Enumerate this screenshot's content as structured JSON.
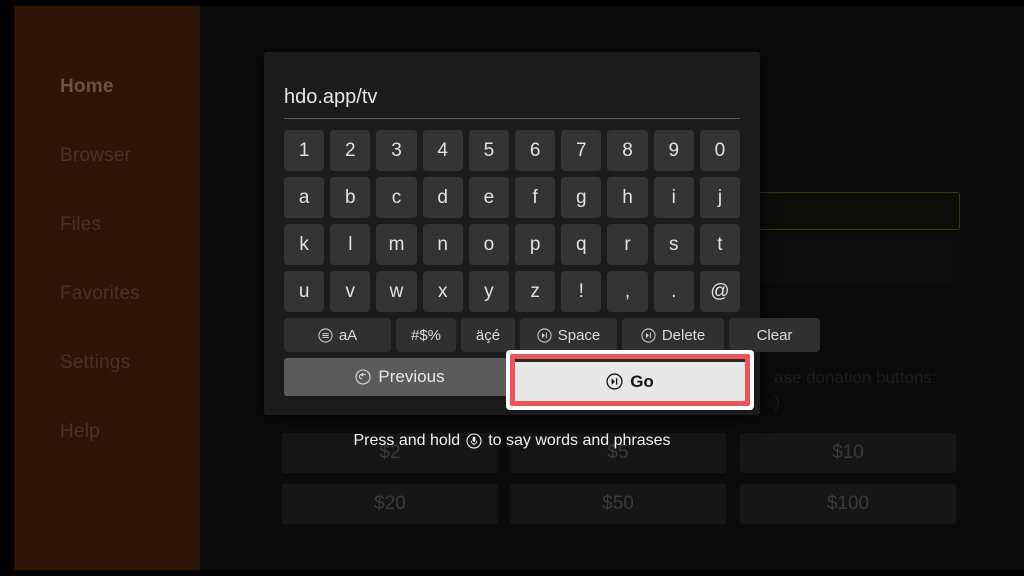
{
  "sidebar": {
    "items": [
      {
        "label": "Home",
        "active": true
      },
      {
        "label": "Browser",
        "active": false
      },
      {
        "label": "Files",
        "active": false
      },
      {
        "label": "Favorites",
        "active": false
      },
      {
        "label": "Settings",
        "active": false
      },
      {
        "label": "Help",
        "active": false
      }
    ]
  },
  "background": {
    "donation_text_line1": "ase donation buttons:",
    "donation_text_line2": ")",
    "buttons": [
      {
        "label": "$2"
      },
      {
        "label": "$5"
      },
      {
        "label": "$10"
      },
      {
        "label": "$20"
      },
      {
        "label": "$50"
      },
      {
        "label": "$100"
      }
    ]
  },
  "keyboard": {
    "input_value": "hdo.app/tv",
    "input_placeholder": "",
    "rows": [
      [
        "1",
        "2",
        "3",
        "4",
        "5",
        "6",
        "7",
        "8",
        "9",
        "0"
      ],
      [
        "a",
        "b",
        "c",
        "d",
        "e",
        "f",
        "g",
        "h",
        "i",
        "j"
      ],
      [
        "k",
        "l",
        "m",
        "n",
        "o",
        "p",
        "q",
        "r",
        "s",
        "t"
      ],
      [
        "u",
        "v",
        "w",
        "x",
        "y",
        "z",
        "!",
        ",",
        ".",
        "@"
      ]
    ],
    "function_keys": {
      "case_label": "aA",
      "case_icon": "menu-circle-icon",
      "symbols_label": "#$%",
      "accents_label": "äçé",
      "space_label": "Space",
      "space_icon": "playpause-circle-icon",
      "delete_label": "Delete",
      "delete_icon": "playpause-circle-icon",
      "clear_label": "Clear"
    },
    "previous_label": "Previous",
    "previous_icon": "back-circle-icon",
    "go_label": "Go",
    "go_icon": "playpause-circle-icon"
  },
  "voice_hint": {
    "text_before": "Press and hold",
    "icon": "microphone-icon",
    "text_after": "to say words and phrases"
  },
  "colors": {
    "sidebar_bg": "#2d1508",
    "dialog_bg": "#1c1c1c",
    "key_bg": "#343434",
    "focus_ring": "#e8565a",
    "go_face": "#e7e7e7"
  }
}
